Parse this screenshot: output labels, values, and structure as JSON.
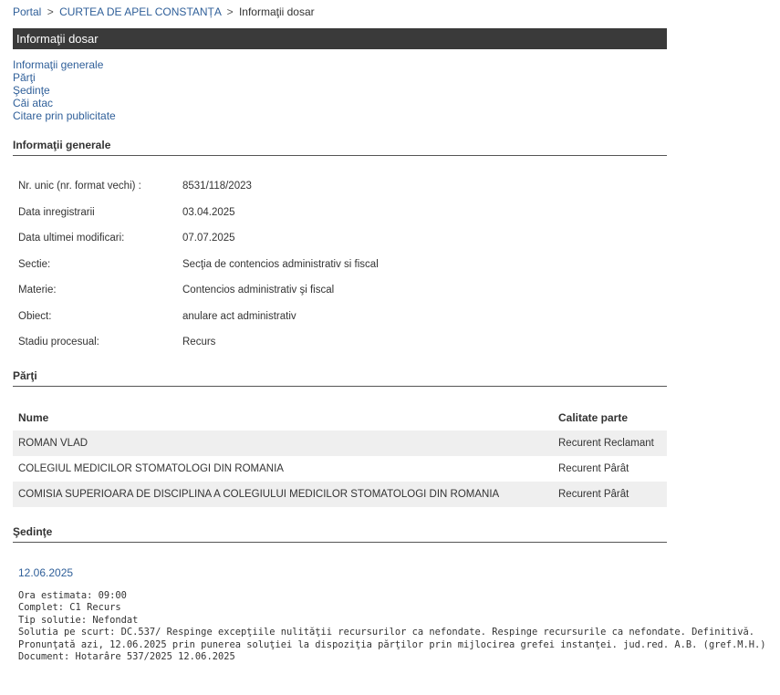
{
  "breadcrumb": {
    "portal": "Portal",
    "court": "CURTEA DE APEL CONSTANȚA",
    "current": "Informaţii dosar",
    "separator": ">"
  },
  "title_bar": "Informaţii dosar",
  "nav": [
    "Informaţii generale",
    "Părţi",
    "Şedinţe",
    "Căi atac",
    "Citare prin publicitate"
  ],
  "general": {
    "heading": "Informaţii generale",
    "rows": [
      {
        "label": "Nr. unic (nr. format vechi) :",
        "value": "8531/118/2023"
      },
      {
        "label": "Data inregistrarii",
        "value": "03.04.2025"
      },
      {
        "label": "Data ultimei modificari:",
        "value": "07.07.2025"
      },
      {
        "label": "Sectie:",
        "value": "Secţia de contencios administrativ si fiscal"
      },
      {
        "label": "Materie:",
        "value": "Contencios administrativ şi fiscal"
      },
      {
        "label": "Obiect:",
        "value": "anulare act administrativ"
      },
      {
        "label": "Stadiu procesual:",
        "value": "Recurs"
      }
    ]
  },
  "parties": {
    "heading": "Părţi",
    "columns": [
      "Nume",
      "Calitate parte"
    ],
    "rows": [
      {
        "name": "ROMAN VLAD",
        "role": "Recurent Reclamant"
      },
      {
        "name": "COLEGIUL MEDICILOR STOMATOLOGI DIN ROMANIA",
        "role": "Recurent Pârât"
      },
      {
        "name": "COMISIA SUPERIOARA DE DISCIPLINA A COLEGIULUI MEDICILOR STOMATOLOGI DIN ROMANIA",
        "role": "Recurent Pârât"
      }
    ]
  },
  "sessions": {
    "heading": "Şedinţe",
    "date": "12.06.2025",
    "lines": [
      "Ora estimata: 09:00",
      "Complet: C1 Recurs",
      "Tip solutie: Nefondat",
      "Solutia pe scurt: DC.537/ Respinge excepţiile nulităţii recursurilor ca nefondate. Respinge recursurile ca nefondate. Definitivă.",
      "Pronunţată azi, 12.06.2025 prin punerea soluţiei la dispoziţia părţilor prin mijlocirea grefei instanţei. jud.red. A.B. (gref.M.H.)",
      "Document: Hotarâre  537/2025  12.06.2025"
    ]
  }
}
